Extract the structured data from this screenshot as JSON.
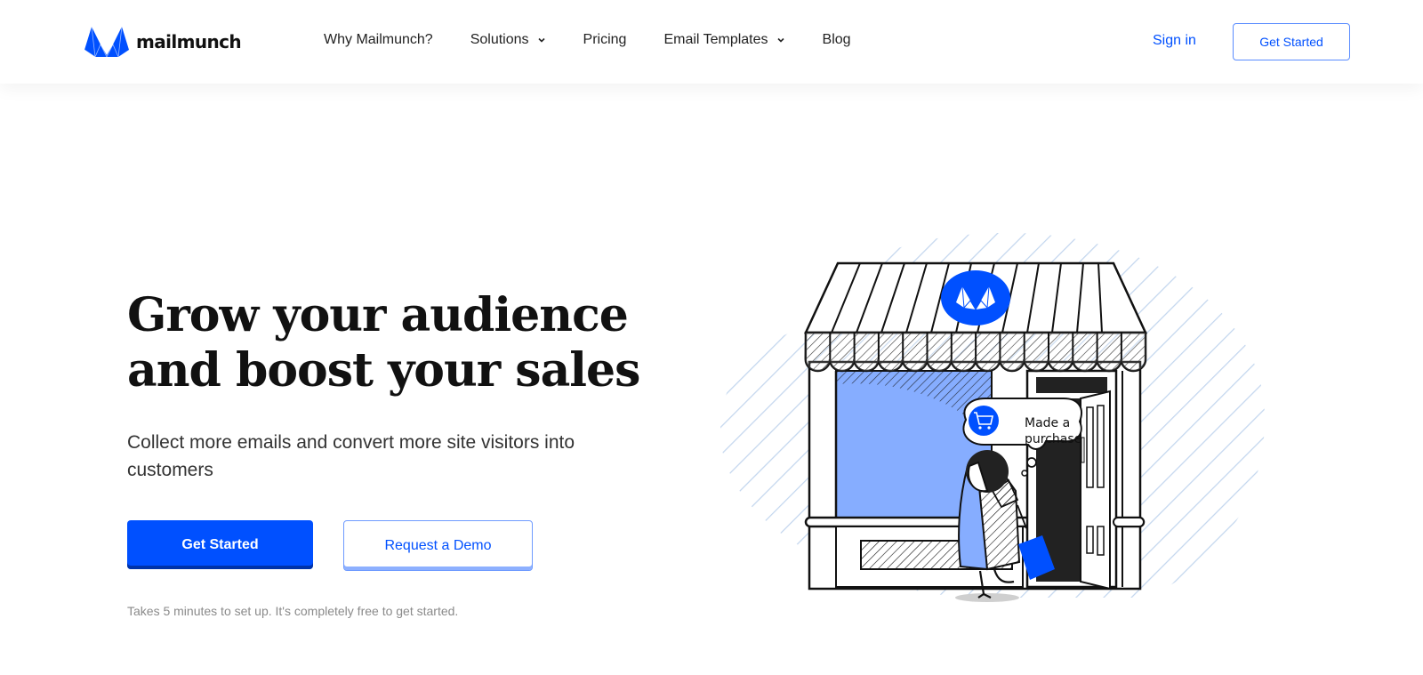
{
  "header": {
    "brand": "mailmunch",
    "nav": [
      {
        "label": "Why Mailmunch?",
        "has_dropdown": false
      },
      {
        "label": "Solutions",
        "has_dropdown": true
      },
      {
        "label": "Pricing",
        "has_dropdown": false
      },
      {
        "label": "Email Templates",
        "has_dropdown": true
      },
      {
        "label": "Blog",
        "has_dropdown": false
      }
    ],
    "signin_label": "Sign in",
    "cta_label": "Get Started"
  },
  "hero": {
    "title_line1": "Grow your audience",
    "title_line2": "and boost your sales",
    "subtitle": "Collect more emails and convert more site visitors into customers",
    "primary_button": "Get Started",
    "secondary_button": "Request a Demo",
    "note": "Takes 5 minutes to set up. It's completely free to get started."
  },
  "illustration": {
    "bubble_line1": "Made a",
    "bubble_line2": "purchase",
    "bubble_icon": "shopping-cart-icon",
    "sign_icon": "mailmunch-logo-icon"
  },
  "colors": {
    "brand_blue": "#0050ff",
    "window_blue": "#86adff",
    "hatch_light": "#c3d6ee",
    "ink": "#111111"
  }
}
